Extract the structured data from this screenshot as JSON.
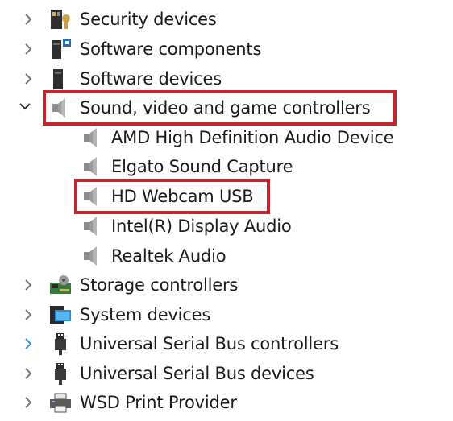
{
  "accent_color": "#c1272d",
  "tree": {
    "top_items": [
      {
        "label": "Security devices",
        "icon": "security-device-icon",
        "expanded": false
      },
      {
        "label": "Software components",
        "icon": "software-component-icon",
        "expanded": false
      },
      {
        "label": "Software devices",
        "icon": "software-device-icon",
        "expanded": false
      },
      {
        "label": "Sound, video and game controllers",
        "icon": "speaker-icon",
        "expanded": true
      }
    ],
    "sound_children": [
      {
        "label": "AMD High Definition Audio Device",
        "icon": "speaker-icon"
      },
      {
        "label": "Elgato Sound Capture",
        "icon": "speaker-icon"
      },
      {
        "label": "HD Webcam USB",
        "icon": "speaker-icon"
      },
      {
        "label": "Intel(R) Display Audio",
        "icon": "speaker-icon"
      },
      {
        "label": "Realtek Audio",
        "icon": "speaker-icon"
      }
    ],
    "bottom_items": [
      {
        "label": "Storage controllers",
        "icon": "storage-controller-icon",
        "expanded": false
      },
      {
        "label": "System devices",
        "icon": "system-devices-icon",
        "expanded": false
      },
      {
        "label": "Universal Serial Bus controllers",
        "icon": "usb-icon",
        "expanded": false
      },
      {
        "label": "Universal Serial Bus devices",
        "icon": "usb-icon",
        "expanded": false
      },
      {
        "label": "WSD Print Provider",
        "icon": "printer-icon",
        "expanded": false
      }
    ]
  }
}
